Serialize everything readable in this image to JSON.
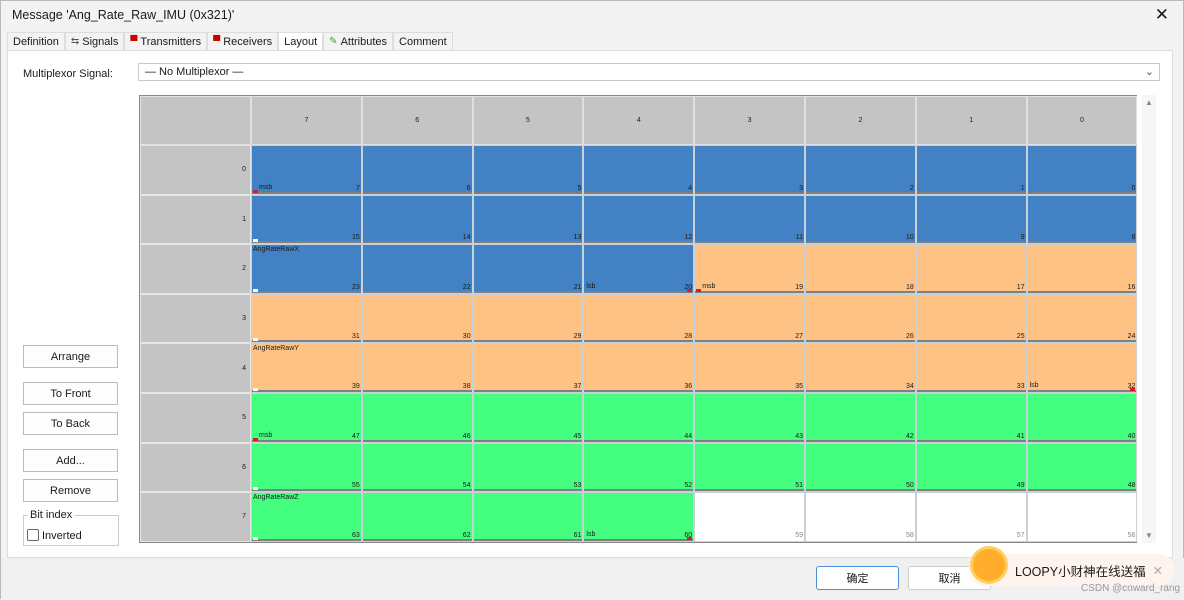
{
  "window": {
    "title": "Message 'Ang_Rate_Raw_IMU (0x321)'",
    "close_icon": "close-icon"
  },
  "tabs": [
    {
      "label": "Definition",
      "icon": ""
    },
    {
      "label": "Signals",
      "icon": "signals-icon"
    },
    {
      "label": "Transmitters",
      "icon": "ecu-icon"
    },
    {
      "label": "Receivers",
      "icon": "ecu-icon"
    },
    {
      "label": "Layout",
      "icon": "",
      "active": true
    },
    {
      "label": "Attributes",
      "icon": "attributes-icon"
    },
    {
      "label": "Comment",
      "icon": ""
    }
  ],
  "multiplexor": {
    "label": "Multiplexor Signal:",
    "value": "— No Multiplexor —"
  },
  "buttons": {
    "arrange": "Arrange",
    "to_front": "To Front",
    "to_back": "To Back",
    "add": "Add...",
    "remove": "Remove"
  },
  "bit_index": {
    "legend": "Bit index",
    "inverted_label": "Inverted",
    "inverted": false
  },
  "layout": {
    "column_headers": [
      "7",
      "6",
      "5",
      "4",
      "3",
      "2",
      "1",
      "0"
    ],
    "row_headers": [
      "0",
      "1",
      "2",
      "3",
      "4",
      "5",
      "6",
      "7"
    ],
    "signals": [
      {
        "name": "AngRateRawX",
        "color": "#4282c4",
        "msb": 7,
        "lsb": 20,
        "label_row": 2,
        "msb_label": "msb",
        "lsb_label": "lsb"
      },
      {
        "name": "AngRateRawY",
        "color": "#ffc285",
        "msb": 19,
        "lsb": 32,
        "label_row": 4,
        "msb_label": "msb",
        "lsb_label": "lsb"
      },
      {
        "name": "AngRateRawZ",
        "color": "#44fe7f",
        "msb": 47,
        "lsb": 60,
        "label_row": 7,
        "msb_label": "msb",
        "lsb_label": "lsb"
      }
    ]
  },
  "footer": {
    "ok": "确定",
    "cancel": "取消"
  },
  "toast": {
    "text": "LOOPY小财神在线送福"
  },
  "watermark": "CSDN @coward_rang"
}
